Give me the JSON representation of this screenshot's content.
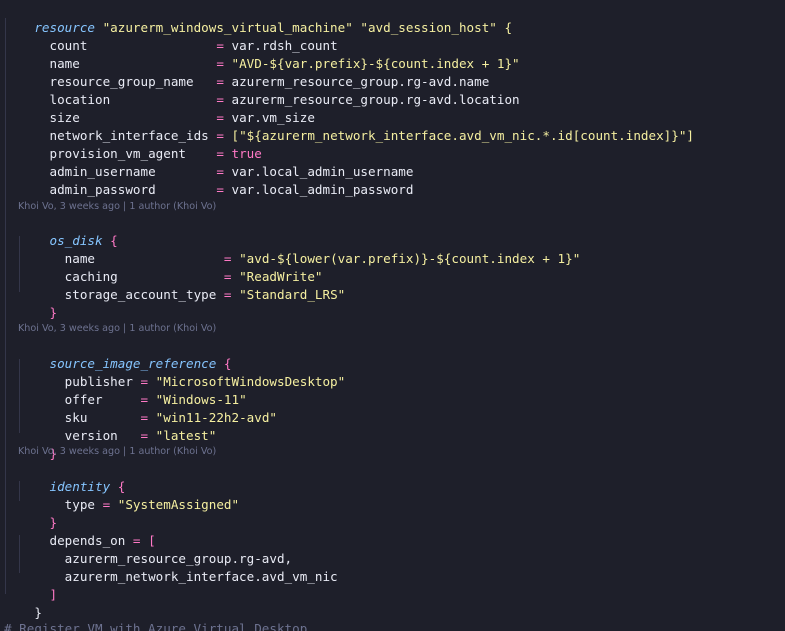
{
  "code": {
    "l1_kw": "resource",
    "l1_rest": " \"azurerm_windows_virtual_machine\" \"avd_session_host\" {",
    "l2_key": "  count                 ",
    "l2_val": "var.rdsh_count",
    "l3_key": "  name                  ",
    "l3_val": "\"AVD-${var.prefix}-${count.index + 1}\"",
    "l4_key": "  resource_group_name   ",
    "l4_val": "azurerm_resource_group.rg-avd.name",
    "l5_key": "  location              ",
    "l5_val": "azurerm_resource_group.rg-avd.location",
    "l6_key": "  size                  ",
    "l6_val": "var.vm_size",
    "l7_key": "  network_interface_ids ",
    "l7_val": "[\"${azurerm_network_interface.avd_vm_nic.*.id[count.index]}\"]",
    "l8_key": "  provision_vm_agent    ",
    "l8_val": "true",
    "l9_key": "  admin_username        ",
    "l9_val": "var.local_admin_username",
    "l10_key": "  admin_password        ",
    "l10_val": "var.local_admin_password",
    "os_disk_kw": "os_disk",
    "os_name_key": "    name                 ",
    "os_name_val": "\"avd-${lower(var.prefix)}-${count.index + 1}\"",
    "os_cache_key": "    caching              ",
    "os_cache_val": "\"ReadWrite\"",
    "os_sat_key": "    storage_account_type ",
    "os_sat_val": "\"Standard_LRS\"",
    "sir_kw": "source_image_reference",
    "pub_key": "    publisher ",
    "pub_val": "\"MicrosoftWindowsDesktop\"",
    "offer_key": "    offer     ",
    "offer_val": "\"Windows-11\"",
    "sku_key": "    sku       ",
    "sku_val": "\"win11-22h2-avd\"",
    "ver_key": "    version   ",
    "ver_val": "\"latest\"",
    "identity_kw": "identity",
    "type_key": "    type ",
    "type_val": "\"SystemAssigned\"",
    "depends_key": "  depends_on ",
    "dep1": "    azurerm_resource_group.rg-avd,",
    "dep2": "    azurerm_network_interface.avd_vm_nic",
    "comment": "# Register VM with Azure Virtual Desktop"
  },
  "blame": {
    "os_disk": "Khoi Vo, 3 weeks ago | 1 author (Khoi Vo)",
    "source_image_reference": "Khoi Vo, 3 weeks ago | 1 author (Khoi Vo)",
    "identity": "Khoi Vo, 3 weeks ago | 1 author (Khoi Vo)"
  },
  "symbols": {
    "eq": "= ",
    "open_brace": " {",
    "close_brace_indent": "  }",
    "close_brace_root": "}",
    "open_bracket": "[",
    "close_bracket_indent": "  ]"
  }
}
